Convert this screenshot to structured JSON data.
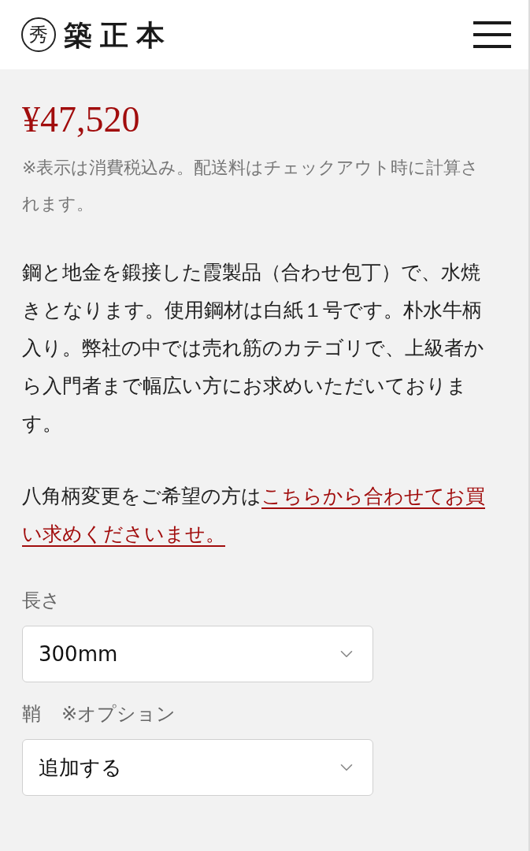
{
  "header": {
    "logo_mark": "秀",
    "logo_text": "築正本"
  },
  "price": "¥47,520",
  "tax_note": "※表示は消費税込み。配送料はチェックアウト時に計算されます。",
  "description": "鋼と地金を鍛接した霞製品（合わせ包丁）で、水焼きとなります。使用鋼材は白紙１号です。朴水牛柄入り。弊社の中では売れ筋のカテゴリで、上級者から入門者まで幅広い方にお求めいただいております。",
  "notice": {
    "text": "八角柄変更をご希望の方は",
    "link_lines": [
      "こちらから合わせてお買",
      "い求めくださいませ。"
    ]
  },
  "options": [
    {
      "label": "長さ",
      "value": "300mm"
    },
    {
      "label": "鞘",
      "note": "※オプション",
      "value": "追加する"
    }
  ]
}
